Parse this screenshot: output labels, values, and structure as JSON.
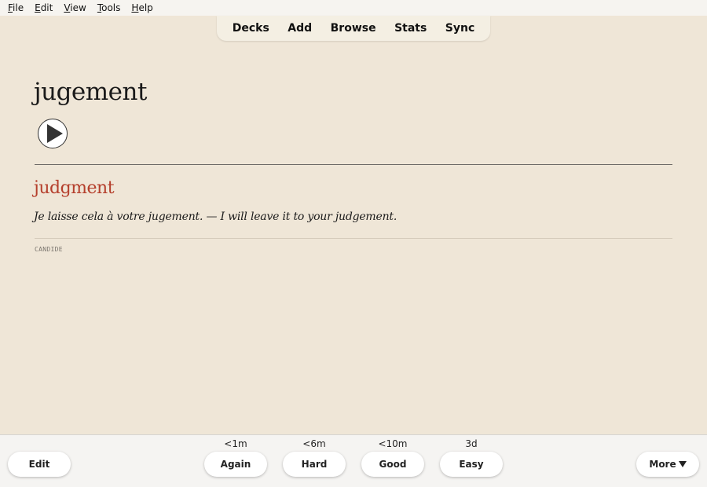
{
  "menubar": {
    "items": [
      "File",
      "Edit",
      "View",
      "Tools",
      "Help"
    ]
  },
  "toolbar": {
    "items": [
      "Decks",
      "Add",
      "Browse",
      "Stats",
      "Sync"
    ]
  },
  "card": {
    "word": "jugement",
    "meaning": "judgment",
    "example": "Je laisse cela à votre jugement. — I will leave it to your judgement.",
    "source": "CANDIDE"
  },
  "bottom": {
    "edit_label": "Edit",
    "more_label": "More",
    "answers": [
      {
        "label": "Again",
        "interval": "<1m"
      },
      {
        "label": "Hard",
        "interval": "<6m"
      },
      {
        "label": "Good",
        "interval": "<10m"
      },
      {
        "label": "Easy",
        "interval": "3d"
      }
    ]
  },
  "colors": {
    "background": "#efe6d7",
    "meaning": "#b5402d"
  }
}
